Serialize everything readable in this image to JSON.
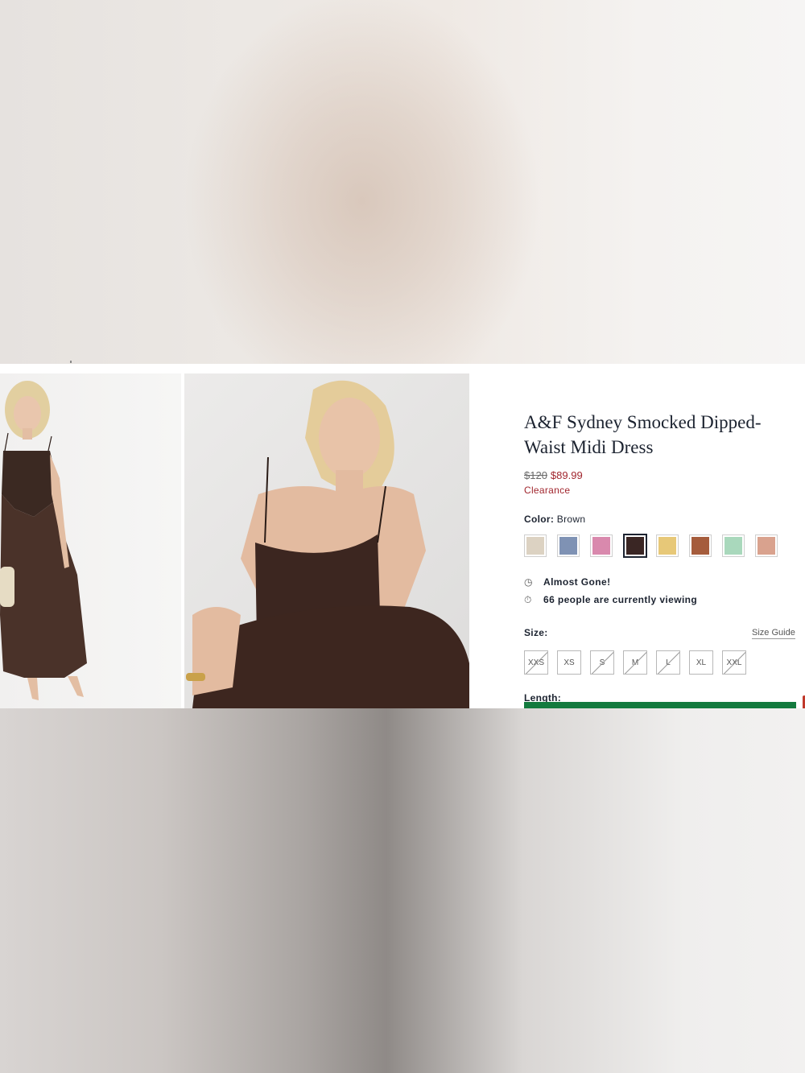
{
  "product": {
    "title": "A&F Sydney Smocked Dipped-Waist Midi Dress",
    "original_price": "$120",
    "sale_price": "$89.99",
    "clearance_label": "Clearance"
  },
  "color": {
    "label": "Color:",
    "selected": "Brown",
    "swatches": [
      {
        "name": "floral-cream",
        "color": "#dcd2c2"
      },
      {
        "name": "blue-print",
        "color": "#7f92b4"
      },
      {
        "name": "pink-print",
        "color": "#d989ad"
      },
      {
        "name": "brown",
        "color": "#3a2624"
      },
      {
        "name": "yellow",
        "color": "#e7c878"
      },
      {
        "name": "rust",
        "color": "#a55c3c"
      },
      {
        "name": "mint",
        "color": "#a9d8bc"
      },
      {
        "name": "blue-orange-floral",
        "color": "#d9a28e"
      }
    ]
  },
  "info": {
    "almost_gone": "Almost Gone!",
    "viewing": "66 people are currently viewing",
    "clock_icon": "clock-icon",
    "stopwatch_icon": "stopwatch-icon"
  },
  "size": {
    "label": "Size:",
    "guide_link": "Size Guide",
    "options": [
      {
        "label": "XXS",
        "available": false
      },
      {
        "label": "XS",
        "available": true
      },
      {
        "label": "S",
        "available": false
      },
      {
        "label": "M",
        "available": false
      },
      {
        "label": "L",
        "available": false
      },
      {
        "label": "XL",
        "available": true
      },
      {
        "label": "XXL",
        "available": false
      }
    ]
  },
  "length": {
    "label": "Length:"
  }
}
